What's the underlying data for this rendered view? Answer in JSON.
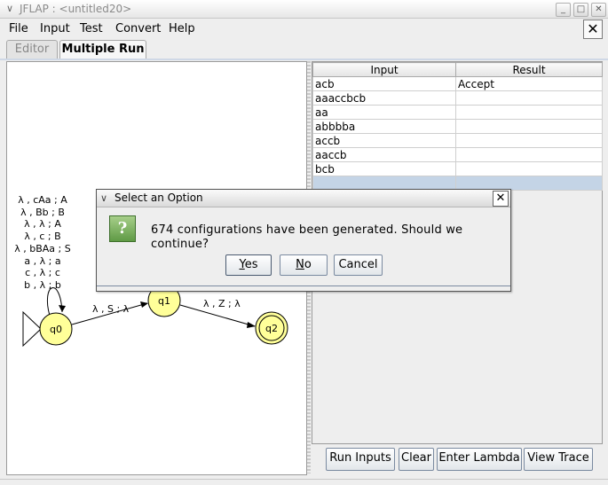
{
  "window": {
    "title": "JFLAP : <untitled20>",
    "controls": [
      "_",
      "□",
      "✕"
    ]
  },
  "menubar": {
    "items": [
      "File",
      "Input",
      "Test",
      "Convert",
      "Help"
    ],
    "close_label": "✕"
  },
  "tabs": [
    {
      "label": "Editor",
      "active": false
    },
    {
      "label": "Multiple Run",
      "active": true
    }
  ],
  "automaton": {
    "states": [
      {
        "id": "q0",
        "initial": true,
        "final": false
      },
      {
        "id": "q1",
        "initial": false,
        "final": false
      },
      {
        "id": "q2",
        "initial": false,
        "final": true
      }
    ],
    "self_loop_q0": [
      "λ , cAa ; A",
      "λ , Bb ; B",
      "λ , λ ; A",
      "λ , c ; B",
      "λ , bBAa ; S",
      "a , λ ; a",
      "c , λ ; c",
      "b , λ ; b"
    ],
    "edge_q0_q1": "λ , S ; λ",
    "edge_q1_q2": "λ , Z ; λ",
    "state_fill": "#ffff99",
    "state_border": "#000000"
  },
  "table": {
    "columns": [
      "Input",
      "Result"
    ],
    "rows": [
      {
        "input": "acb",
        "result": "Accept"
      },
      {
        "input": "aaaccbcb",
        "result": ""
      },
      {
        "input": "aa",
        "result": ""
      },
      {
        "input": "abbbba",
        "result": ""
      },
      {
        "input": "accb",
        "result": ""
      },
      {
        "input": "aaccb",
        "result": ""
      },
      {
        "input": "bcb",
        "result": ""
      },
      {
        "input": "",
        "result": ""
      }
    ],
    "selected_row_color": "#c4d4e6"
  },
  "buttons": {
    "run_inputs": "Run Inputs",
    "clear": "Clear",
    "enter_lambda": "Enter Lambda",
    "view_trace": "View Trace"
  },
  "dialog": {
    "title": "Select an Option",
    "message": "674 configurations have been generated.  Should we continue?",
    "icon_glyph": "?",
    "yes_mnemonic": "Y",
    "yes_rest": "es",
    "no_mnemonic": "N",
    "no_rest": "o",
    "cancel": "Cancel",
    "close_label": "✕"
  }
}
